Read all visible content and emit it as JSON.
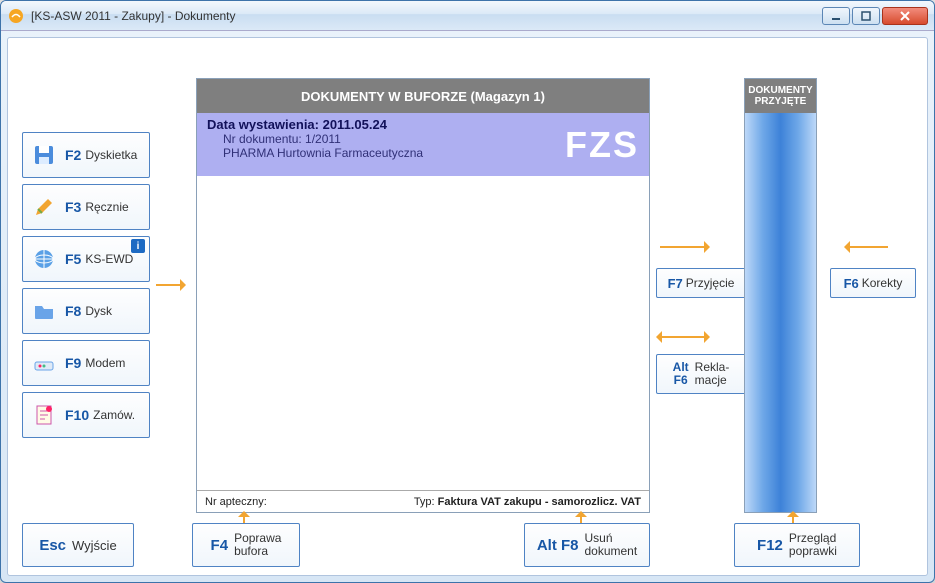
{
  "window": {
    "title": "[KS-ASW 2011 - Zakupy] - Dokumenty"
  },
  "left_buttons": [
    {
      "key": "F2",
      "label": "Dyskietka",
      "icon": "floppy"
    },
    {
      "key": "F3",
      "label": "Ręcznie",
      "icon": "pencil"
    },
    {
      "key": "F5",
      "label": "KS-EWD",
      "icon": "globe",
      "info": true
    },
    {
      "key": "F8",
      "label": "Dysk",
      "icon": "folder"
    },
    {
      "key": "F9",
      "label": "Modem",
      "icon": "modem"
    },
    {
      "key": "F10",
      "label": "Zamów.",
      "icon": "note"
    }
  ],
  "buffer": {
    "title": "DOKUMENTY W BUFORZE (Magazyn 1)",
    "doc": {
      "issue_label": "Data wystawienia: 2011.05.24",
      "number": "Nr dokumentu: 1/2011",
      "contractor": "PHARMA Hurtownia Farmaceutyczna",
      "type_code": "FZS"
    },
    "footer": {
      "pharm_no_label": "Nr apteczny:",
      "type_label": "Typ:",
      "type_value": "Faktura VAT zakupu - samorozlicz. VAT"
    }
  },
  "accepted": {
    "title_line1": "DOKUMENTY",
    "title_line2": "PRZYJĘTE"
  },
  "mid_buttons": {
    "accept": {
      "key": "F7",
      "label": "Przyjęcie"
    },
    "reklam": {
      "key1": "Alt",
      "key2": "F6",
      "line1": "Rekla-",
      "line2": "macje"
    },
    "korekty": {
      "key": "F6",
      "label": "Korekty"
    }
  },
  "bottom_buttons": {
    "exit": {
      "key": "Esc",
      "label": "Wyjście"
    },
    "fix": {
      "key": "F4",
      "line1": "Poprawa",
      "line2": "bufora"
    },
    "delete": {
      "key": "Alt F8",
      "line1": "Usuń",
      "line2": "dokument"
    },
    "review": {
      "key": "F12",
      "line1": "Przegląd",
      "line2": "poprawki"
    }
  }
}
